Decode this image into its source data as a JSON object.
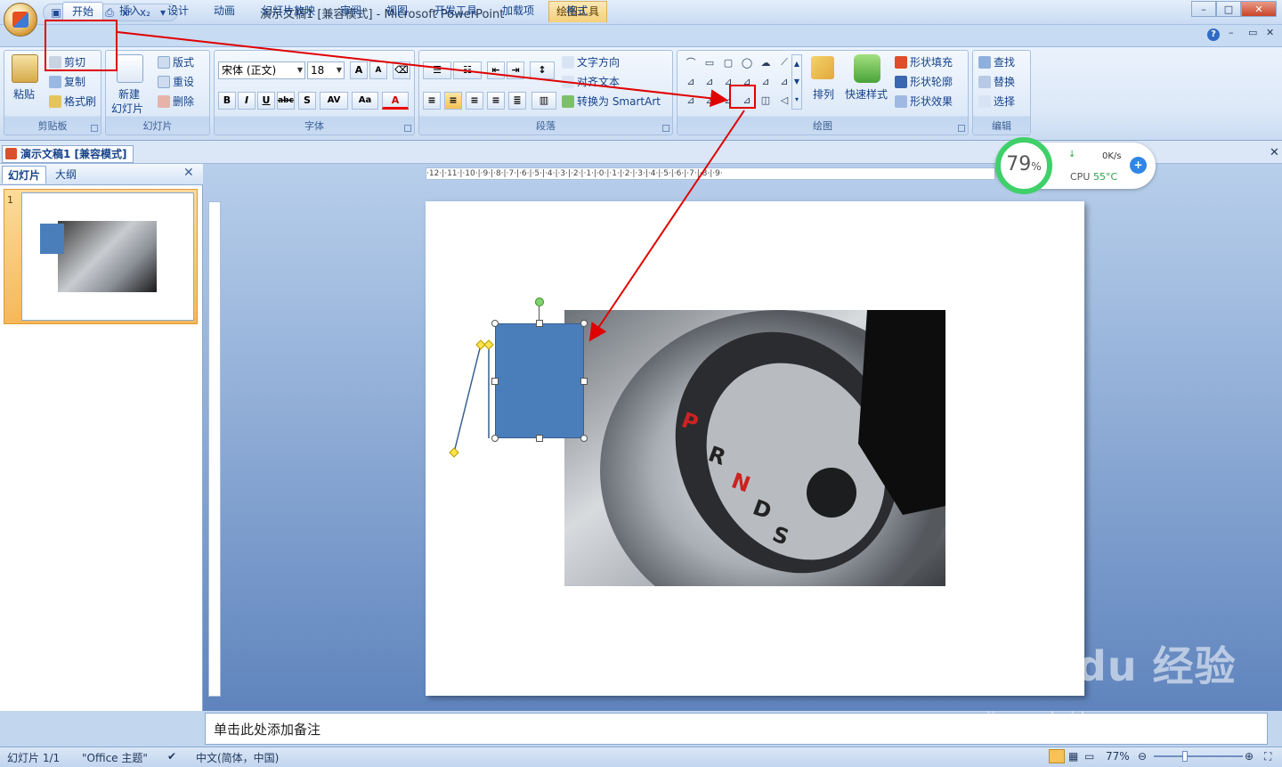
{
  "title_bar": {
    "app_title": "演示文稿1 [兼容模式] - Microsoft PowerPoint",
    "context_tools": "绘图工具",
    "minimize": "–",
    "maximize": "□",
    "close": "✕"
  },
  "tabs": {
    "home": "开始",
    "insert": "插入",
    "design": "设计",
    "animation": "动画",
    "slideshow": "幻灯片放映",
    "review": "审阅",
    "view": "视图",
    "developer": "开发工具",
    "addins": "加载项",
    "format": "格式"
  },
  "ribbon": {
    "clipboard": {
      "label": "剪贴板",
      "paste": "粘贴",
      "cut": "剪切",
      "copy": "复制",
      "format_painter": "格式刷"
    },
    "slides": {
      "label": "幻灯片",
      "new_slide_1": "新建",
      "new_slide_2": "幻灯片",
      "layout": "版式",
      "reset": "重设",
      "delete": "删除"
    },
    "font": {
      "label": "字体",
      "font_name": "宋体 (正文)",
      "font_size": "18"
    },
    "paragraph": {
      "label": "段落",
      "text_direction": "文字方向",
      "align_text": "对齐文本",
      "convert_smartart": "转换为 SmartArt"
    },
    "drawing": {
      "label": "绘图",
      "arrange": "排列",
      "quick_styles": "快速样式",
      "shape_fill": "形状填充",
      "shape_outline": "形状轮廓",
      "shape_effects": "形状效果"
    },
    "editing": {
      "label": "编辑",
      "find": "查找",
      "replace": "替换",
      "select": "选择"
    }
  },
  "doc_tab": "演示文稿1 [兼容模式]",
  "left_pane": {
    "tab_slides": "幻灯片",
    "tab_outline": "大纲",
    "slide_number": "1"
  },
  "notes_placeholder": "单击此处添加备注",
  "status": {
    "slide_count": "幻灯片 1/1",
    "theme": "\"Office 主题\"",
    "language": "中文(简体，中国)",
    "zoom": "77%"
  },
  "cpu_widget": {
    "percent": "79",
    "percent_sign": "%",
    "net": "0K/s",
    "cpu_label": "CPU",
    "cpu_temp": "55°C"
  },
  "watermark": {
    "brand": "Bai du 经验",
    "url": "jingyan.baidu.com"
  },
  "ruler": {
    "h_ticks": "·12·|·11·|·10·|·9·|·8·|·7·|·6·|·5·|·4·|·3·|·2·|·1·|·0·|·1·|·2·|·3·|·4·|·5·|·6·|·7·|·8·|·9·"
  },
  "colors": {
    "accent": "#e00000",
    "shape_fill": "#4a7ebb",
    "ribbon_bg": "#dce8f8"
  }
}
